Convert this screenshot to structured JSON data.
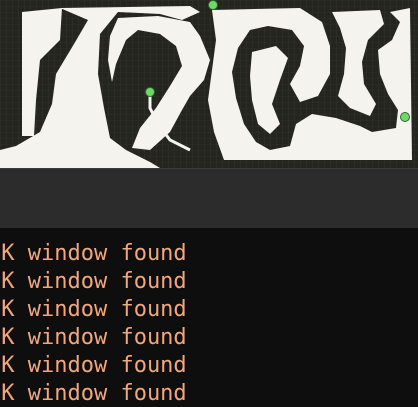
{
  "viewer": {
    "background": "#ecebe6",
    "wall_color": "#252520",
    "marker_color": "#6fd86a",
    "markers": [
      "start-marker",
      "agent-marker",
      "goal-marker"
    ]
  },
  "terminal": {
    "text_color": "#f2a77b",
    "lines": [
      "OK window found",
      "OK window found",
      "OK window found",
      "OK window found",
      "OK window found",
      "OK window found"
    ]
  }
}
